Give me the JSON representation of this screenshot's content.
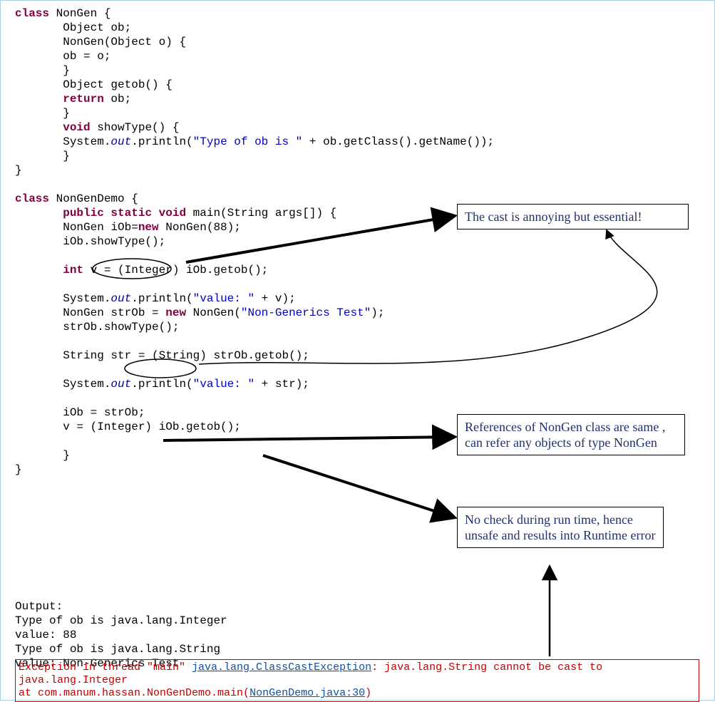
{
  "code": {
    "ln1_kw": "class",
    "ln1_rest": " NonGen {",
    "ln2": "       Object ob;",
    "ln3": "       NonGen(Object o) {",
    "ln4": "       ob = o;",
    "ln5": "       }",
    "ln6": "       Object getob() {",
    "ln7_kw": "return",
    "ln7_rest": " ob;",
    "ln8": "       }",
    "ln9_kw": "void",
    "ln9_rest": " showType() {",
    "ln10_a": "       System.",
    "ln10_out": "out",
    "ln10_b": ".println(",
    "ln10_str": "\"Type of ob is \"",
    "ln10_c": " + ob.getClass().getName());",
    "ln11": "       }",
    "ln12": "}",
    "ln14_kw": "class",
    "ln14_rest": " NonGenDemo {",
    "ln15_kw": "public static void",
    "ln15_rest": " main(String args[]) {",
    "ln16_a": "       NonGen iOb=",
    "ln16_kw": "new",
    "ln16_b": " NonGen(88);",
    "ln17": "       iOb.showType();",
    "ln19_kw": "int",
    "ln19_rest": " v = (Integer) iOb.getob();",
    "ln21_a": "       System.",
    "ln21_out": "out",
    "ln21_b": ".println(",
    "ln21_str": "\"value: \"",
    "ln21_c": " + v);",
    "ln22_a": "       NonGen strOb = ",
    "ln22_kw": "new",
    "ln22_b": " NonGen(",
    "ln22_str": "\"Non-Generics Test\"",
    "ln22_c": ");",
    "ln23": "       strOb.showType();",
    "ln25": "       String str = (String) strOb.getob();",
    "ln27_a": "       System.",
    "ln27_out": "out",
    "ln27_b": ".println(",
    "ln27_str": "\"value: \"",
    "ln27_c": " + str);",
    "ln29": "       iOb = strOb;",
    "ln30": "       v = (Integer) iOb.getob();",
    "ln32": "       }",
    "ln33": "}"
  },
  "boxes": {
    "b1": "The cast is annoying but essential!",
    "b2": "References of NonGen class are same , can refer any objects of type NonGen",
    "b3": "No check during run time, hence unsafe and results into Runtime error"
  },
  "output": {
    "title": "Output:",
    "l1": "Type of ob is java.lang.Integer",
    "l2": "value: 88",
    "l3": "Type of ob is java.lang.String",
    "l4": "value: Non-Generics Test"
  },
  "error": {
    "pre": "Exception in thread \"main\" ",
    "cls": "java.lang.ClassCastException",
    "mid": ": java.lang.String cannot be cast to java.lang.Integer",
    "at": "       at com.manum.hassan.NonGenDemo.main(",
    "loc": "NonGenDemo.java:30",
    "end": ")"
  }
}
